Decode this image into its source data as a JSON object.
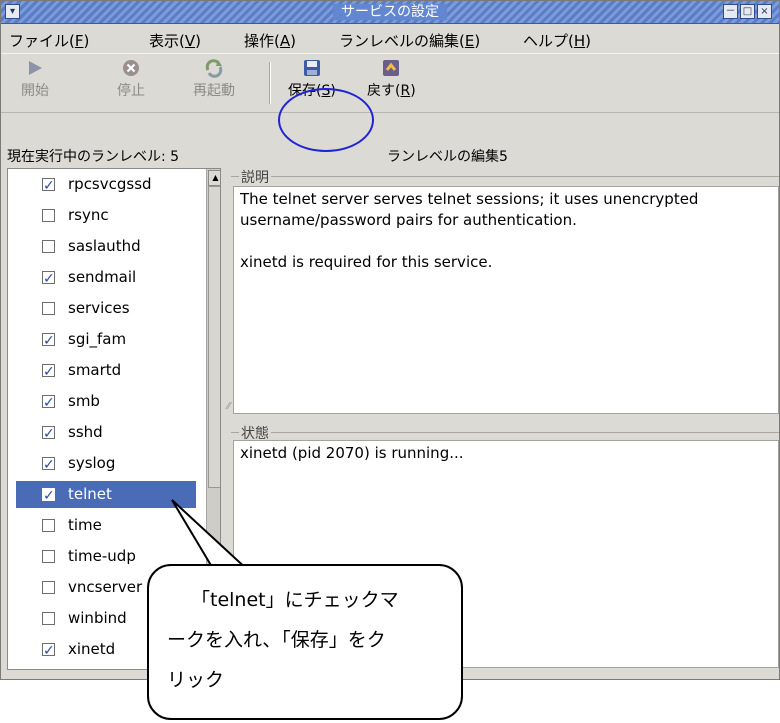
{
  "window": {
    "title": "サービスの設定",
    "title_buttons": [
      "－",
      "□",
      "×"
    ]
  },
  "menu": {
    "items": [
      {
        "label": "ファイル(",
        "key": "F",
        "tail": ")"
      },
      {
        "label": "表示(",
        "key": "V",
        "tail": ")"
      },
      {
        "label": "操作(",
        "key": "A",
        "tail": ")"
      },
      {
        "label": "ランレベルの編集(",
        "key": "E",
        "tail": ")"
      },
      {
        "label": "ヘルプ(",
        "key": "H",
        "tail": ")"
      }
    ]
  },
  "toolbar": {
    "start_label": "開始",
    "stop_label": "停止",
    "restart_label": "再起動",
    "save_label": "保存(",
    "save_key": "S",
    "save_tail": ")",
    "revert_label": "戻す(",
    "revert_key": "R",
    "revert_tail": ")"
  },
  "status": {
    "current_runlevel": "現在実行中のランレベル: 5",
    "editing_runlevel": "ランレベルの編集5"
  },
  "services": [
    {
      "name": "rpcsvcgssd",
      "checked": true
    },
    {
      "name": "rsync",
      "checked": false
    },
    {
      "name": "saslauthd",
      "checked": false
    },
    {
      "name": "sendmail",
      "checked": true
    },
    {
      "name": "services",
      "checked": false
    },
    {
      "name": "sgi_fam",
      "checked": true
    },
    {
      "name": "smartd",
      "checked": true
    },
    {
      "name": "smb",
      "checked": true
    },
    {
      "name": "sshd",
      "checked": true
    },
    {
      "name": "syslog",
      "checked": true
    },
    {
      "name": "telnet",
      "checked": true,
      "selected": true
    },
    {
      "name": "time",
      "checked": false
    },
    {
      "name": "time-udp",
      "checked": false
    },
    {
      "name": "vncserver",
      "checked": false
    },
    {
      "name": "winbind",
      "checked": false
    },
    {
      "name": "xinetd",
      "checked": true
    }
  ],
  "description": {
    "label": "説明",
    "text_line1": "The telnet server serves telnet sessions; it uses unencrypted",
    "text_line2": "username/password pairs for authentication.",
    "text_line3": "xinetd is required for this service."
  },
  "state": {
    "label": "状態",
    "text": "xinetd (pid 2070) is running..."
  },
  "callout": {
    "line1": "「telnet」にチェックマ",
    "line2": "ークを入れ、「保存」をク",
    "line3": "リック"
  },
  "colors": {
    "selection": "#4a6bb6",
    "titlebar": "#6286d0",
    "circle": "#1f24d6"
  }
}
